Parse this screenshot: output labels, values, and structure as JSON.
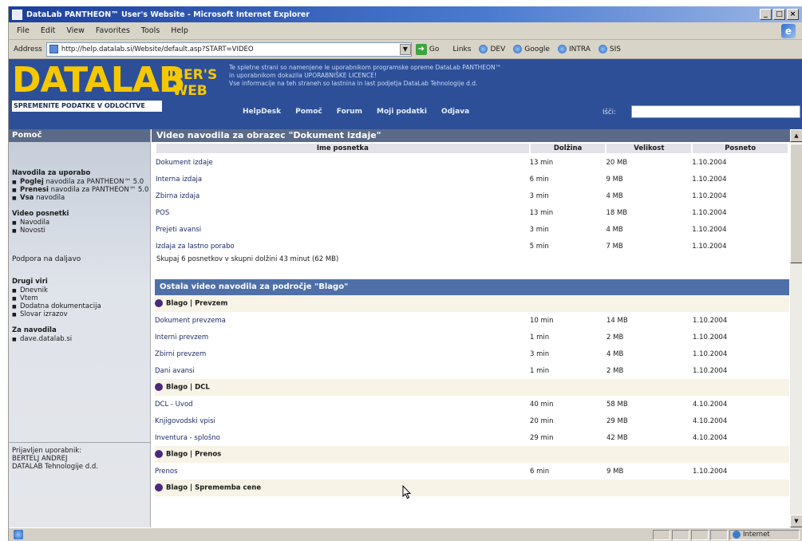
{
  "window": {
    "title": "DataLab PANTHEON™ User's Website - Microsoft Internet Explorer",
    "controls": [
      "_",
      "□",
      "×"
    ]
  },
  "menu": [
    "File",
    "Edit",
    "View",
    "Favorites",
    "Tools",
    "Help"
  ],
  "address": {
    "label": "Address",
    "url": "http://help.datalab.si/Website/default.asp?START=VIDEO",
    "go_label": "Go",
    "links_label": "Links",
    "links": [
      "DEV",
      "Google",
      "INTRA",
      "SIS"
    ]
  },
  "header": {
    "logo": "DATALAB",
    "logo_sub_line1": "USER'S",
    "logo_sub_line2": "WEB",
    "tagline": "SPREMENITE PODATKE V ODLOČITVE",
    "info_line1": "Te spletne strani so namenjene le uporabnikom programske opreme DataLab PANTHEON™",
    "info_line2": "in uporabnikom dokazila UPORABNIŠKE LICENCE!",
    "info_line3": "Vse informacije na teh straneh so lastnina in last podjetja DataLab Tehnologije d.d.",
    "nav": [
      "HelpDesk",
      "Pomoč",
      "Forum",
      "Moji podatki",
      "Odjava"
    ],
    "search_label": "Išči:"
  },
  "sidebar": {
    "heading": "Pomoč",
    "manuals_title": "Navodila za uporabo",
    "manuals": [
      {
        "bold": "Poglej",
        "rest": " navodila za PANTHEON™ 5.0"
      },
      {
        "bold": "Prenesi",
        "rest": " navodila za PANTHEON™ 5.0"
      },
      {
        "bold": "Vsa",
        "rest": " navodila"
      }
    ],
    "video_title": "Video posnetki",
    "video_items": [
      "Navodila",
      "Novosti"
    ],
    "support": "Podpora na daljavo",
    "other_title": "Drugi viri",
    "other_items": [
      "Dnevnik",
      "Vtem",
      "Dodatna dokumentacija",
      "Slovar izrazov"
    ],
    "feedback_title": "Za navodila",
    "feedback_items": [
      "dave.datalab.si"
    ],
    "footer_line1": "Prijavljen uporabnik:",
    "footer_line2": "BERTELJ ANDREJ",
    "footer_line3": "DATALAB Tehnologije d.d."
  },
  "main": {
    "title": "Video navodila za obrazec \"Dokument izdaje\"",
    "columns": [
      "Ime posnetka",
      "Dolžina",
      "Velikost",
      "Posneto"
    ],
    "rows": [
      [
        "Dokument izdaje",
        "13 min",
        "20 MB",
        "1.10.2004"
      ],
      [
        "Interna izdaja",
        "6 min",
        "9 MB",
        "1.10.2004"
      ],
      [
        "Zbirna izdaja",
        "3 min",
        "4 MB",
        "1.10.2004"
      ],
      [
        "POS",
        "13 min",
        "18 MB",
        "1.10.2004"
      ],
      [
        "Prejeti avansi",
        "3 min",
        "4 MB",
        "1.10.2004"
      ],
      [
        "Izdaja za lastno porabo",
        "5 min",
        "7 MB",
        "1.10.2004"
      ]
    ],
    "summary": "Skupaj 6 posnetkov v skupni dolžini 43 minut (62 MB)",
    "other_title": "Ostala video navodila za področje \"Blago\"",
    "groups": [
      {
        "name": "Blago | Prevzem",
        "rows": [
          [
            "Dokument prevzema",
            "10 min",
            "14 MB",
            "1.10.2004"
          ],
          [
            "Interni prevzem",
            "1 min",
            "2 MB",
            "1.10.2004"
          ],
          [
            "Zbirni prevzem",
            "3 min",
            "4 MB",
            "1.10.2004"
          ],
          [
            "Dani avansi",
            "1 min",
            "2 MB",
            "1.10.2004"
          ]
        ]
      },
      {
        "name": "Blago | DCL",
        "rows": [
          [
            "DCL - Uvod",
            "40 min",
            "58 MB",
            "4.10.2004"
          ],
          [
            "Knjigovodski vpisi",
            "20 min",
            "29 MB",
            "4.10.2004"
          ],
          [
            "Inventura - splošno",
            "29 min",
            "42 MB",
            "4.10.2004"
          ]
        ]
      },
      {
        "name": "Blago | Prenos",
        "rows": [
          [
            "Prenos",
            "6 min",
            "9 MB",
            "1.10.2004"
          ]
        ]
      },
      {
        "name": "Blago | Sprememba cene",
        "rows": []
      }
    ]
  },
  "status": {
    "zone": "Internet"
  }
}
